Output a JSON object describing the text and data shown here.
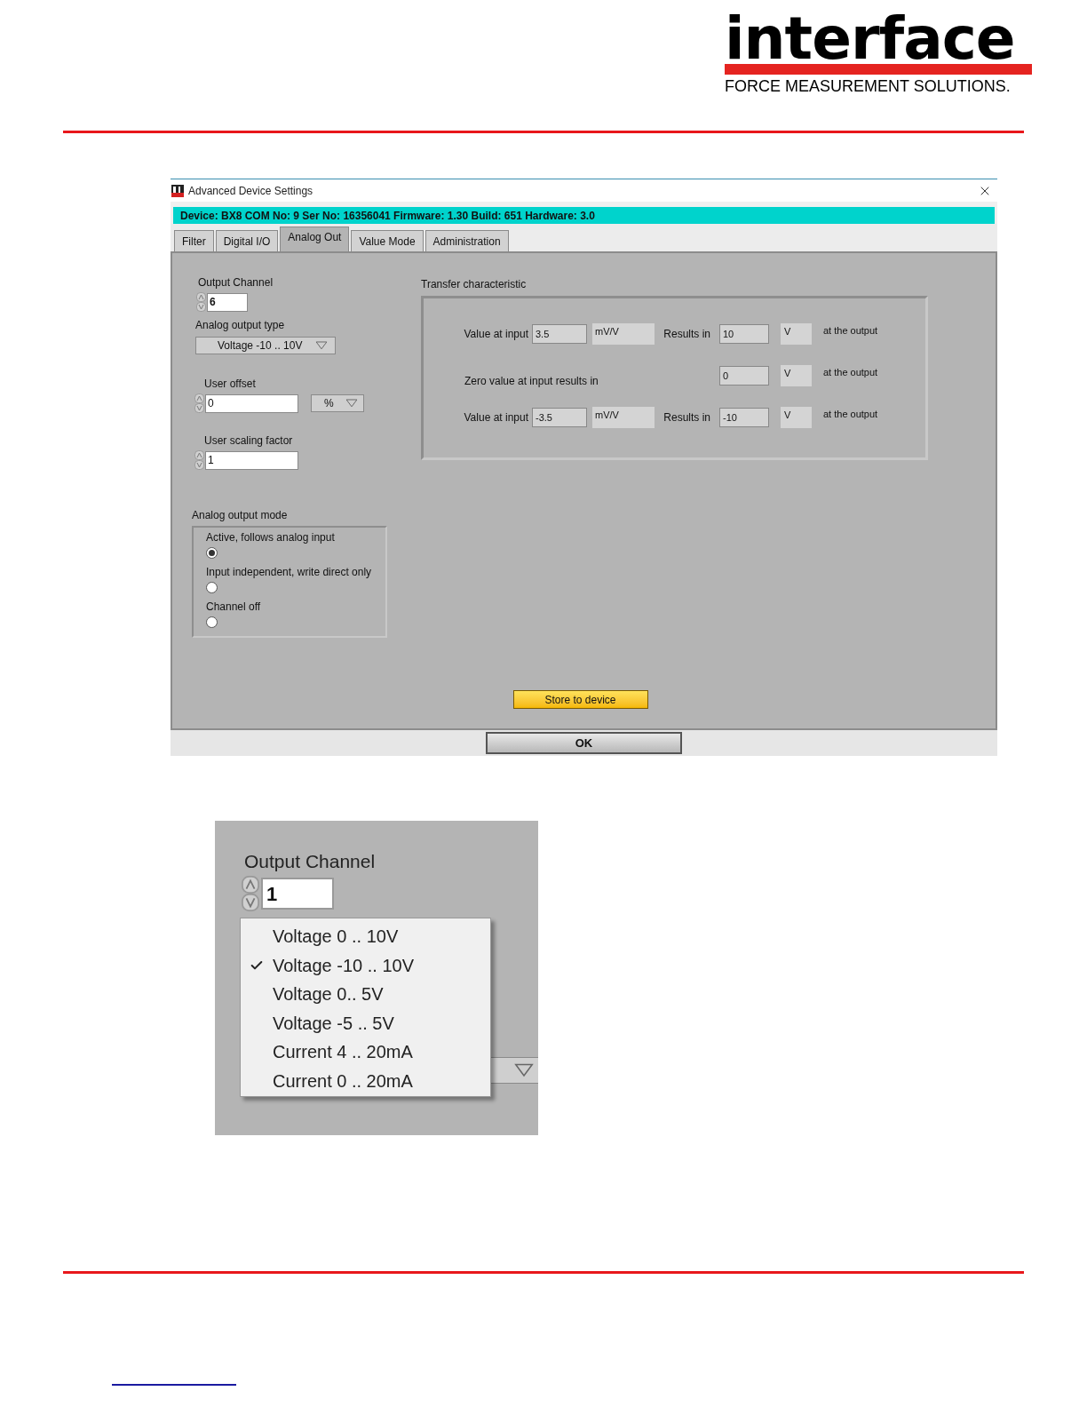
{
  "logo": {
    "wordmark": "interface",
    "tagline": "FORCE MEASUREMENT SOLUTIONS."
  },
  "window": {
    "title": "Advanced Device Settings",
    "device_info": "Device: BX8 COM No: 9 Ser No: 16356041 Firmware: 1.30 Build: 651 Hardware: 3.0"
  },
  "tabs": [
    {
      "label": "Filter",
      "selected": false
    },
    {
      "label": "Digital I/O",
      "selected": false
    },
    {
      "label": "Analog Out",
      "selected": true
    },
    {
      "label": "Value Mode",
      "selected": false
    },
    {
      "label": "Administration",
      "selected": false
    }
  ],
  "output_channel": {
    "label": "Output Channel",
    "value": "6"
  },
  "analog_output_type": {
    "label": "Analog output type",
    "value": "Voltage -10 .. 10V"
  },
  "user_offset": {
    "label": "User offset",
    "value": "0",
    "unit": "%"
  },
  "user_scaling_factor": {
    "label": "User scaling factor",
    "value": "1"
  },
  "transfer": {
    "title": "Transfer characteristic",
    "rows": [
      {
        "kind": "input",
        "label": "Value at input",
        "input_value": "3.5",
        "input_unit": "mV/V",
        "results_label": "Results in",
        "output_value": "10",
        "output_unit": "V",
        "suffix": "at the output"
      },
      {
        "kind": "zero",
        "label": "Zero value at input results in",
        "output_value": "0",
        "output_unit": "V",
        "suffix": "at the output"
      },
      {
        "kind": "input",
        "label": "Value at input",
        "input_value": "-3.5",
        "input_unit": "mV/V",
        "results_label": "Results in",
        "output_value": "-10",
        "output_unit": "V",
        "suffix": "at the output"
      }
    ]
  },
  "output_mode": {
    "label": "Analog output mode",
    "options": [
      {
        "label": "Active, follows analog input",
        "selected": true
      },
      {
        "label": "Input independent, write direct only",
        "selected": false
      },
      {
        "label": "Channel off",
        "selected": false
      }
    ]
  },
  "store_button": "Store to device",
  "ok_button": "OK",
  "inset": {
    "output_channel": {
      "label": "Output Channel",
      "value": "1"
    },
    "menu": [
      {
        "label": "Voltage 0 .. 10V",
        "checked": false
      },
      {
        "label": "Voltage -10 .. 10V",
        "checked": true
      },
      {
        "label": "Voltage 0.. 5V",
        "checked": false
      },
      {
        "label": "Voltage -5 .. 5V",
        "checked": false
      },
      {
        "label": "Current 4 .. 20mA",
        "checked": false
      },
      {
        "label": "Current 0 .. 20mA",
        "checked": false
      }
    ]
  }
}
